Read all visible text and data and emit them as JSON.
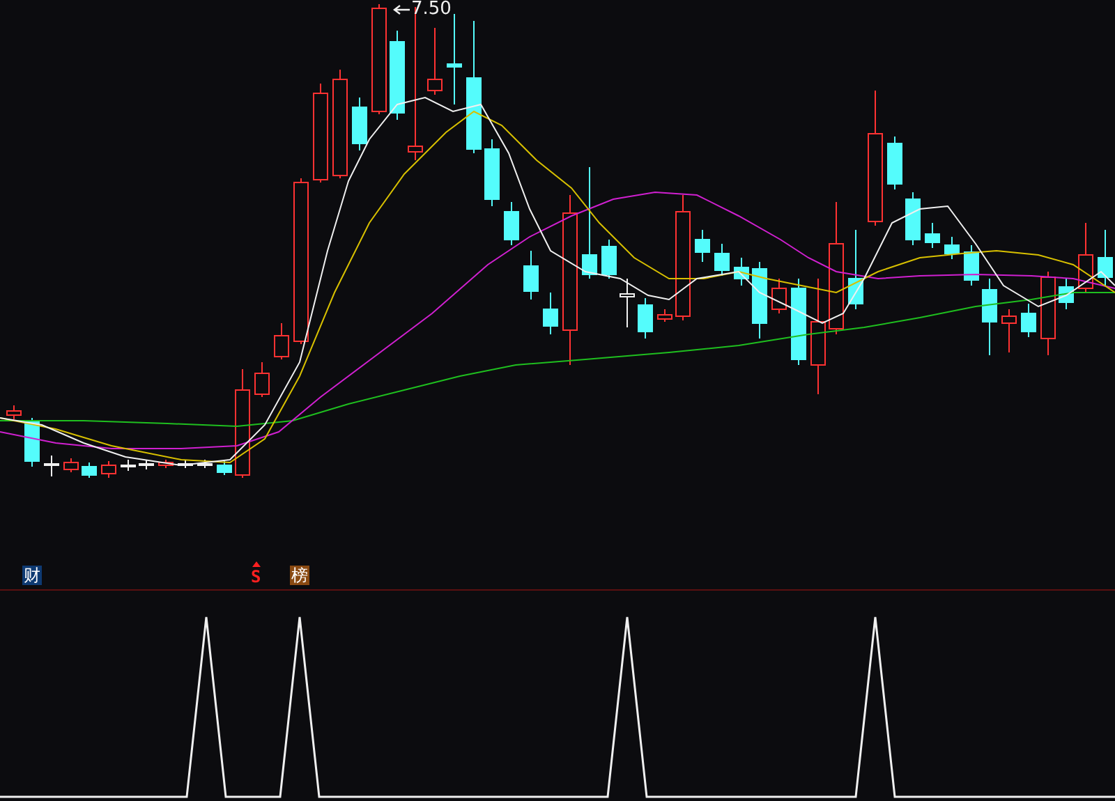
{
  "price_panel": {
    "high_label": "7.50"
  },
  "signal_markers": [
    {
      "kind": "finance",
      "text": "财"
    },
    {
      "kind": "buy",
      "text": "S"
    },
    {
      "kind": "ranking",
      "text": "榜"
    }
  ]
}
